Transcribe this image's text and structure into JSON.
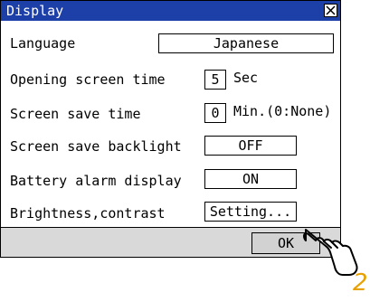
{
  "window": {
    "title": "Display"
  },
  "settings": {
    "language": {
      "label": "Language",
      "value": "Japanese"
    },
    "opening_screen_time": {
      "label": "Opening screen time",
      "value": "5",
      "unit": "Sec"
    },
    "screen_save_time": {
      "label": "Screen save time",
      "value": "0",
      "unit": "Min.(0:None)"
    },
    "screen_save_backlight": {
      "label": "Screen save backlight",
      "value": "OFF"
    },
    "battery_alarm_display": {
      "label": "Battery alarm display",
      "value": "ON"
    },
    "brightness_contrast": {
      "label": "Brightness,contrast",
      "button": "Setting..."
    }
  },
  "footer": {
    "ok_label": "OK"
  },
  "annotation": {
    "step_number": "2",
    "hand_icon": "pointing-hand-icon",
    "step_color": "#e8a100"
  },
  "colors": {
    "titlebar": "#1d3fa8",
    "footer": "#d9d9d9"
  }
}
